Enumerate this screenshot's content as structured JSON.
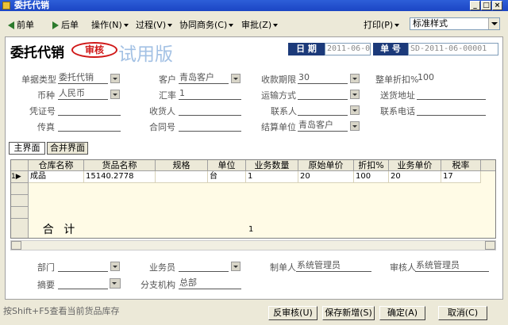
{
  "window": {
    "title": "委托代销"
  },
  "toolbar": {
    "prev": "前单",
    "next": "后单",
    "operate": "操作(N)",
    "process": "过程(V)",
    "collab": "协同商务(C)",
    "approve": "审批(Z)",
    "print": "打印(P)",
    "style_value": "标准样式"
  },
  "header": {
    "title": "委托代销",
    "stamp": "审核",
    "trial": "试用版",
    "date_label": "日 期",
    "date_value": "2011-06-02",
    "docno_label": "单 号",
    "docno_value": "SD-2011-06-00001"
  },
  "form": {
    "doctype_label": "单据类型",
    "doctype_value": "委托代销",
    "customer_label": "客户",
    "customer_value": "青岛客户",
    "term_label": "收款期限",
    "term_value": "30",
    "discount_label": "整单折扣%",
    "discount_value": "100",
    "currency_label": "币种",
    "currency_value": "人民币",
    "rate_label": "汇率",
    "rate_value": "1",
    "shipping_label": "运输方式",
    "shipping_value": "",
    "address_label": "送货地址",
    "address_value": "",
    "voucher_label": "凭证号",
    "voucher_value": "",
    "receiver_label": "收货人",
    "receiver_value": "",
    "contact_label": "联系人",
    "contact_value": "",
    "phone_label": "联系电话",
    "phone_value": "",
    "fax_label": "传真",
    "fax_value": "",
    "contract_label": "合同号",
    "contract_value": "",
    "settle_label": "结算单位",
    "settle_value": "青岛客户"
  },
  "tabs": {
    "main": "主界面",
    "merge": "合并界面"
  },
  "grid": {
    "columns": [
      "仓库名称",
      "货品名称",
      "规格",
      "单位",
      "业务数量",
      "原始单价",
      "折扣%",
      "业务单价",
      "税率"
    ],
    "rows": [
      {
        "marker": "1▶",
        "cells": [
          "成品",
          "15140.2778",
          "",
          "台",
          "1",
          "20",
          "100",
          "20",
          "17"
        ]
      }
    ],
    "total_label": "合 计",
    "total_qty": "1"
  },
  "footer": {
    "dept_label": "部门",
    "dept_value": "",
    "staff_label": "业务员",
    "staff_value": "",
    "maker_label": "制单人",
    "maker_value": "系统管理员",
    "auditor_label": "审核人",
    "auditor_value": "系统管理员",
    "memo_label": "摘要",
    "memo_value": "",
    "branch_label": "分支机构",
    "branch_value": "总部"
  },
  "status_text": "按Shift+F5查看当前货品库存",
  "buttons": {
    "unaudit": "反审核(U)",
    "save_new": "保存新增(S)",
    "ok": "确定(A)",
    "cancel": "取消(C)"
  }
}
